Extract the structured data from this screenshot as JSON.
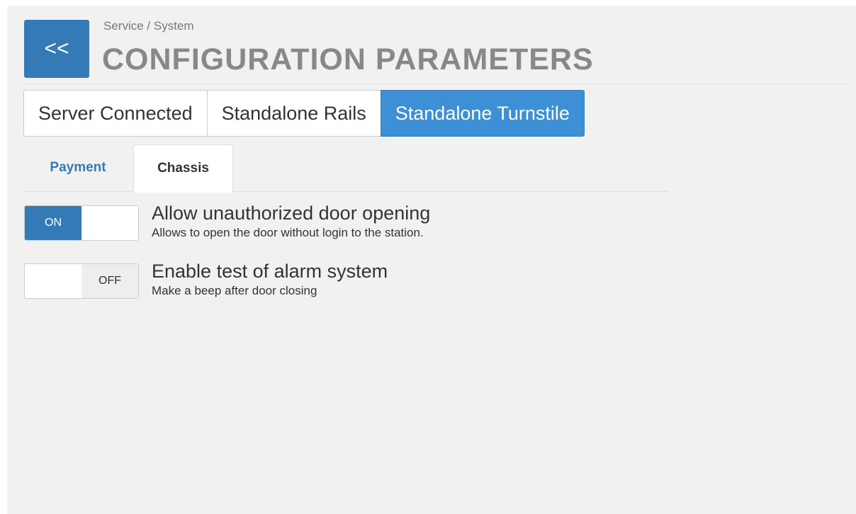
{
  "header": {
    "back_label": "<<",
    "breadcrumb": "Service / System",
    "title": "CONFIGURATION PARAMETERS"
  },
  "modes": [
    {
      "label": "Server Connected",
      "active": false
    },
    {
      "label": "Standalone Rails",
      "active": false
    },
    {
      "label": "Standalone Turnstile",
      "active": true
    }
  ],
  "subtabs": [
    {
      "label": "Payment",
      "active": false
    },
    {
      "label": "Chassis",
      "active": true
    }
  ],
  "settings": [
    {
      "title": "Allow unauthorized door opening",
      "description": "Allows to open the door without login to the station.",
      "state": "ON",
      "on": true
    },
    {
      "title": "Enable test of alarm system",
      "description": "Make a beep after door closing",
      "state": "OFF",
      "on": false
    }
  ],
  "colors": {
    "accent": "#337ab7",
    "active_mode": "#3d8fd6",
    "background": "#f1f1f1"
  },
  "icons": {
    "back": "double-chevron-left-icon"
  }
}
